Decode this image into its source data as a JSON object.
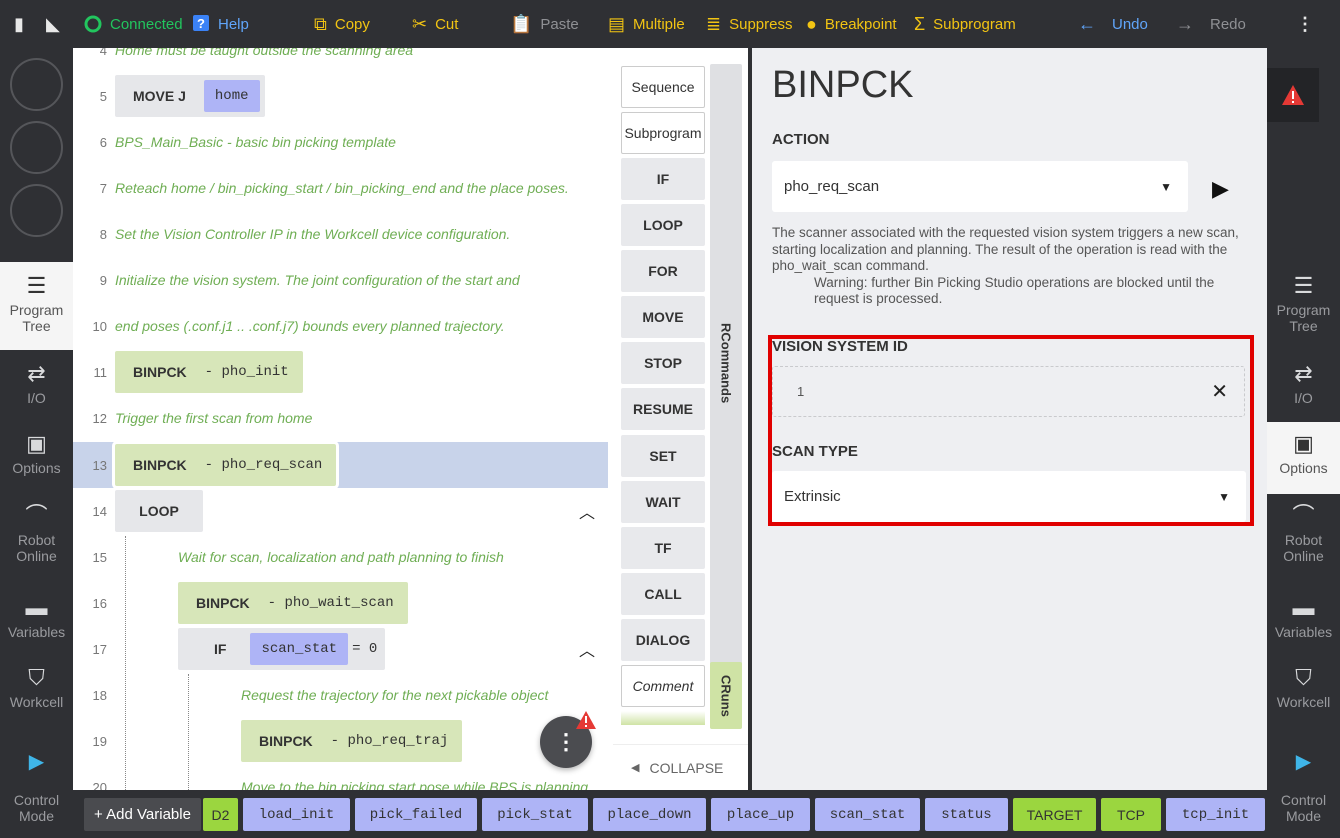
{
  "toolbar": {
    "status_label": "Connected",
    "help_label": "Help",
    "copy_label": "Copy",
    "cut_label": "Cut",
    "paste_label": "Paste",
    "multiple_label": "Multiple",
    "suppress_label": "Suppress",
    "breakpoint_label": "Breakpoint",
    "subprogram_label": "Subprogram",
    "undo_label": "Undo",
    "redo_label": "Redo"
  },
  "left_nav": {
    "program_tree": "Program Tree",
    "io": "I/O",
    "options": "Options",
    "robot_online": "Robot Online",
    "variables": "Variables",
    "workcell": "Workcell",
    "control_mode": "Control Mode"
  },
  "right_nav": {
    "program_tree": "Program Tree",
    "io": "I/O",
    "options": "Options",
    "robot_online": "Robot Online",
    "variables": "Variables",
    "workcell": "Workcell",
    "control_mode": "Control Mode"
  },
  "program": {
    "line4_num": "4",
    "line4_text": "Home must be taught outside the scanning area",
    "line5_num": "5",
    "line5_kw": "MOVE J",
    "line5_var": "home",
    "line6_num": "6",
    "line6_text": "BPS_Main_Basic - basic bin picking template",
    "line7_num": "7",
    "line7_text": "Reteach home / bin_picking_start / bin_picking_end and the place poses.",
    "line8_num": "8",
    "line8_text": "Set the Vision Controller IP in the Workcell device configuration.",
    "line9_num": "9",
    "line9_text": "Initialize the vision system. The joint configuration of the start and",
    "line10_num": "10",
    "line10_text": "end poses (.conf.j1 .. .conf.j7) bounds every planned trajectory.",
    "line11_num": "11",
    "line11_kw": "BINPCK",
    "line11_arg": "- pho_init",
    "line12_num": "12",
    "line12_text": "Trigger the first scan from home",
    "line13_num": "13",
    "line13_kw": "BINPCK",
    "line13_arg": "- pho_req_scan",
    "line14_num": "14",
    "line14_kw": "LOOP",
    "line15_num": "15",
    "line15_text": "Wait for scan, localization and path planning to finish",
    "line16_num": "16",
    "line16_kw": "BINPCK",
    "line16_arg": "- pho_wait_scan",
    "line17_num": "17",
    "line17_kw": "IF",
    "line17_var": "scan_stat",
    "line17_eq": "= 0",
    "line18_num": "18",
    "line18_text": "Request the trajectory for the next pickable object",
    "line19_num": "19",
    "line19_kw": "BINPCK",
    "line19_arg": "- pho_req_traj",
    "line20_num": "20",
    "line20_text": "Move to the bin picking start pose while BPS is planning"
  },
  "commands": {
    "items": [
      "Sequence",
      "Subprogram",
      "IF",
      "LOOP",
      "FOR",
      "MOVE",
      "STOP",
      "RESUME",
      "SET",
      "WAIT",
      "TF",
      "CALL",
      "DIALOG",
      "Comment"
    ],
    "tab_rcommands": "RCommands",
    "tab_cruns": "CRuns",
    "collapse_label": "COLLAPSE"
  },
  "detail": {
    "title": "BINPCK",
    "action_label": "ACTION",
    "action_value": "pho_req_scan",
    "description": "The scanner associated with the requested vision system triggers a new scan, starting localization and planning. The result of the operation is read with the pho_wait_scan command.",
    "warning": "Warning: further Bin Picking Studio operations are blocked until the request is processed.",
    "vision_id_label": "VISION SYSTEM ID",
    "vision_id_value": "1",
    "scan_type_label": "SCAN TYPE",
    "scan_type_value": "Extrinsic"
  },
  "variables_bar": {
    "add_label": "+ Add Variable",
    "vars": [
      "D2",
      "load_init",
      "pick_failed",
      "pick_stat",
      "place_down",
      "place_up",
      "scan_stat",
      "status",
      "TARGET",
      "TCP",
      "tcp_init"
    ]
  },
  "colors": {
    "accent_yellow": "#f2c413",
    "connected_green": "#22c55e",
    "undo_blue": "#60a5fa",
    "highlight_red": "#e00000",
    "comment_green": "#6fae54",
    "var_purple": "#aeb4f6",
    "var_lime": "#9bd63f"
  }
}
